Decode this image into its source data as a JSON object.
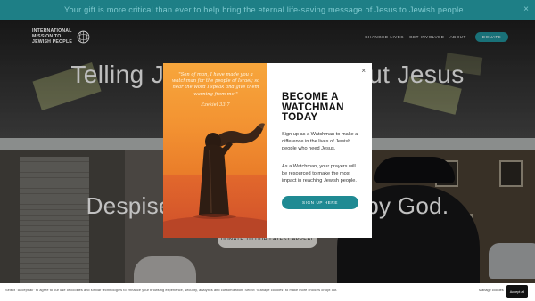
{
  "announcement": {
    "text": "Your gift is more critical than ever to help bring the eternal life-saving message of Jesus to Jewish people...",
    "close_label": "×"
  },
  "header": {
    "logo_lines": [
      "INTERNATIONAL",
      "MISSION TO",
      "JEWISH PEOPLE"
    ],
    "logo_emblem_icon": "globe-emblem-icon",
    "nav": [
      "CHANGED LIVES",
      "GET INVOLVED",
      "ABOUT"
    ],
    "donate_label": "DONATE"
  },
  "hero": {
    "title": "Telling Jewish People About Jesus"
  },
  "section2": {
    "title": "Despised by man, chosen by God.",
    "appeal_label": "DONATE TO OUR LATEST APPEAL"
  },
  "modal": {
    "quote": "\"Son of man, I have made you a watchman for the people of Israel; so hear the word I speak and give them warning from me.\"",
    "quote_ref": "Ezekiel 33:7",
    "close_label": "×",
    "heading": "BECOME A WATCHMAN TODAY",
    "paragraph1": "Sign up as a Watchman to make a difference in the lives of Jewish people who need Jesus.",
    "paragraph2": "As a Watchman, your prayers will be resourced to make the most impact in reaching Jewish people.",
    "signup_label": "SIGN UP HERE"
  },
  "cookie": {
    "text": "Select \"Accept all\" to agree to our use of cookies and similar technologies to enhance your browsing experience, security, analytics and customization. Select \"Manage cookies\" to make more choices or opt out.",
    "manage_label": "Manage cookies",
    "accept_label": "Accept all"
  },
  "colors": {
    "teal": "#1f8a93",
    "orange": "#f39332",
    "dark_bg": "#2b2b2b"
  }
}
